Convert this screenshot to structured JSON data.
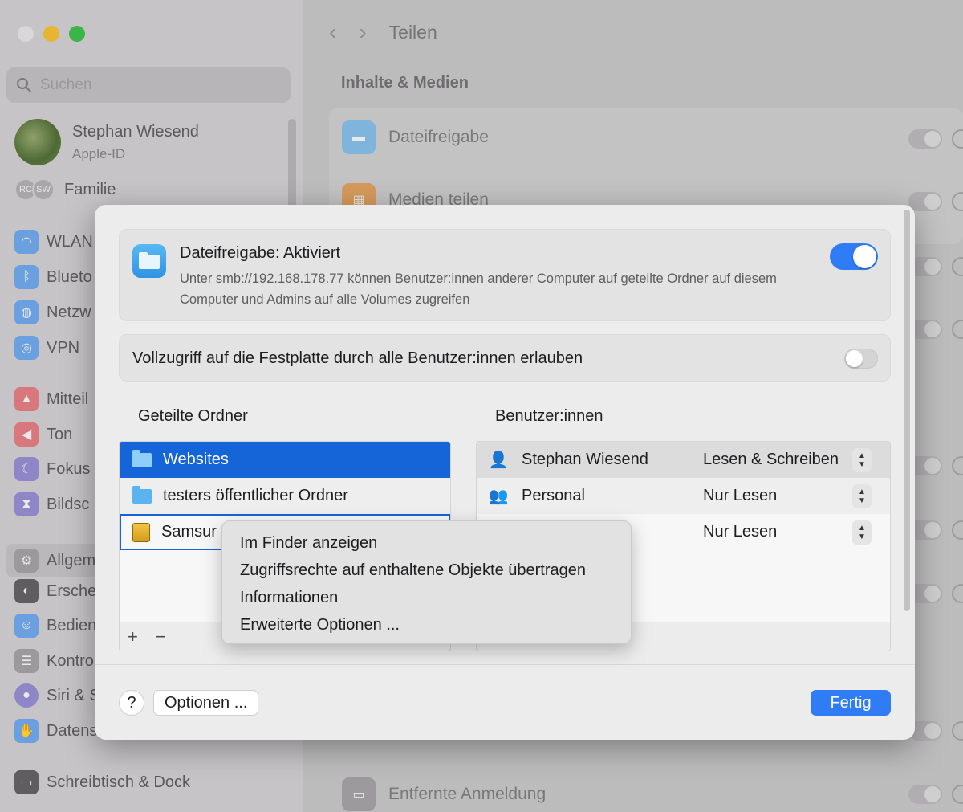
{
  "sidebar": {
    "search_placeholder": "Suchen",
    "profile": {
      "name": "Stephan Wiesend",
      "subtitle": "Apple-ID"
    },
    "family": {
      "badges": [
        "RC",
        "SW"
      ],
      "label": "Familie"
    },
    "items": [
      {
        "label": "WLAN",
        "icon": "wifi-icon",
        "color": "#6aa0e0"
      },
      {
        "label": "Blueto",
        "icon": "bluetooth-icon",
        "color": "#6aa0e0"
      },
      {
        "label": "Netzw",
        "icon": "globe-icon",
        "color": "#6aa0e0"
      },
      {
        "label": "VPN",
        "icon": "vpn-icon",
        "color": "#6aa0e0"
      },
      {
        "label": "Mitteil",
        "icon": "bell-icon",
        "color": "#d9787c"
      },
      {
        "label": "Ton",
        "icon": "speaker-icon",
        "color": "#d9787c"
      },
      {
        "label": "Fokus",
        "icon": "moon-icon",
        "color": "#8f86c8"
      },
      {
        "label": "Bildsc",
        "icon": "hourglass-icon",
        "color": "#8f86c8"
      },
      {
        "label": "Allgem",
        "icon": "gear-icon",
        "color": "#9b999b"
      },
      {
        "label": "Ersche",
        "icon": "appearance-icon",
        "color": "#5f5d5f"
      },
      {
        "label": "Bedien",
        "icon": "accessibility-icon",
        "color": "#6aa0e0"
      },
      {
        "label": "Kontro",
        "icon": "control-center-icon",
        "color": "#9b999b"
      },
      {
        "label": "Siri & S",
        "icon": "siri-icon",
        "color": "#8f86c8"
      },
      {
        "label": "Datens",
        "icon": "hand-icon",
        "color": "#6aa0e0"
      },
      {
        "label": "Schreibtisch & Dock",
        "icon": "dock-icon",
        "color": "#5f5d5f"
      }
    ]
  },
  "main": {
    "title": "Teilen",
    "section": "Inhalte & Medien",
    "rows": [
      {
        "label": "Dateifreigabe",
        "icon": "folder-icon"
      },
      {
        "label": "Medien teilen",
        "icon": "media-icon"
      },
      {
        "label": "Entfernte Anmeldung",
        "icon": "terminal-icon"
      }
    ]
  },
  "sheet": {
    "file_sharing": {
      "title": "Dateifreigabe: Aktiviert",
      "description": "Unter smb://192.168.178.77 können Benutzer:innen anderer Computer auf geteilte Ordner auf diesem Computer und Admins auf alle Volumes zugreifen",
      "enabled": true
    },
    "full_access": {
      "label": "Vollzugriff auf die Festplatte durch alle Benutzer:innen erlauben",
      "enabled": false
    },
    "folders": {
      "heading": "Geteilte Ordner",
      "items": [
        {
          "label": "Websites",
          "icon": "folder-icon"
        },
        {
          "label": "testers öffentlicher Ordner",
          "icon": "folder-icon"
        },
        {
          "label": "Samsur",
          "icon": "drive-icon"
        }
      ],
      "add_label": "+",
      "remove_label": "−"
    },
    "users": {
      "heading": "Benutzer:innen",
      "items": [
        {
          "name": "Stephan Wiesend",
          "permission": "Lesen & Schreiben",
          "icon": "person-icon"
        },
        {
          "name": "Personal",
          "permission": "Nur Lesen",
          "icon": "group-icon"
        },
        {
          "name": "",
          "permission": "Nur Lesen",
          "icon": ""
        }
      ]
    },
    "help_label": "?",
    "options_label": "Optionen ...",
    "done_label": "Fertig"
  },
  "context_menu": {
    "items": [
      "Im Finder anzeigen",
      "Zugriffsrechte auf enthaltene Objekte übertragen",
      "Informationen",
      "Erweiterte Optionen ..."
    ]
  },
  "colors": {
    "accent": "#2f7cf6",
    "selection": "#1565d8"
  }
}
